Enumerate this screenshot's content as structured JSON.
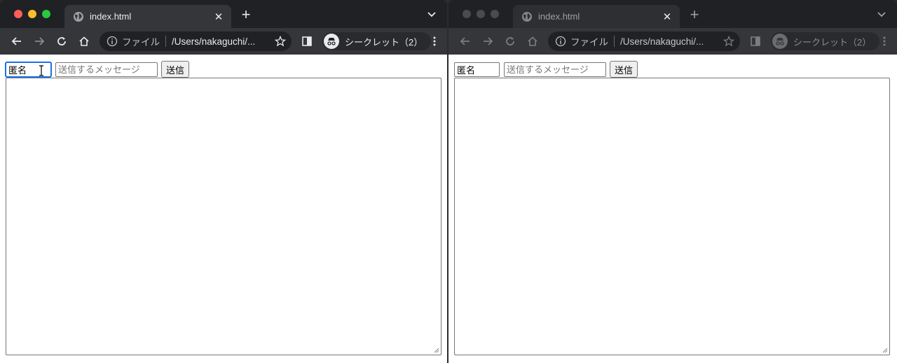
{
  "windows": [
    {
      "tab_title": "index.html",
      "url_scheme": "ファイル",
      "url_path": "/Users/nakaguchi/...",
      "incognito_label": "シークレット（2）",
      "form": {
        "name_value": "匿名",
        "message_placeholder": "送信するメッセージ",
        "send_label": "送信"
      }
    },
    {
      "tab_title": "index.html",
      "url_scheme": "ファイル",
      "url_path": "/Users/nakaguchi/...",
      "incognito_label": "シークレット（2）",
      "form": {
        "name_value": "匿名",
        "message_placeholder": "送信するメッセージ",
        "send_label": "送信"
      }
    }
  ],
  "icons": {
    "globe": "globe-icon",
    "back": "back-arrow-icon",
    "forward": "forward-arrow-icon",
    "reload": "reload-icon",
    "home": "home-icon",
    "info": "info-icon",
    "star": "star-icon",
    "side_panel": "side-panel-icon",
    "incognito": "incognito-icon",
    "menu": "kebab-menu-icon"
  },
  "colors": {
    "focus_ring": "#1a73e8",
    "frame": "#202124",
    "toolbar": "#35363a"
  }
}
